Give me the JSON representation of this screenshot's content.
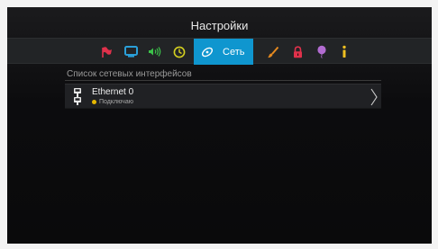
{
  "header": {
    "title": "Настройки"
  },
  "tabs": [
    {
      "icon": "flag-icon",
      "color": "#e0314b"
    },
    {
      "icon": "monitor-icon",
      "color": "#2a9fd8"
    },
    {
      "icon": "speaker-icon",
      "color": "#3cc24a"
    },
    {
      "icon": "clock-icon",
      "color": "#d4d020"
    },
    {
      "icon": "network-icon",
      "label": "Сеть",
      "active": true,
      "color": "#0f96cf"
    },
    {
      "icon": "brush-icon",
      "color": "#e68a1f"
    },
    {
      "icon": "lock-icon",
      "color": "#e0314b"
    },
    {
      "icon": "balloon-icon",
      "color": "#b26cd1"
    },
    {
      "icon": "info-icon",
      "color": "#f0c020"
    }
  ],
  "section": {
    "title": "Список сетевых интерфейсов"
  },
  "interfaces": [
    {
      "name": "Ethernet 0",
      "status": "Подключаю",
      "status_color": "#e6b800",
      "icon": "ethernet-port-icon"
    }
  ]
}
